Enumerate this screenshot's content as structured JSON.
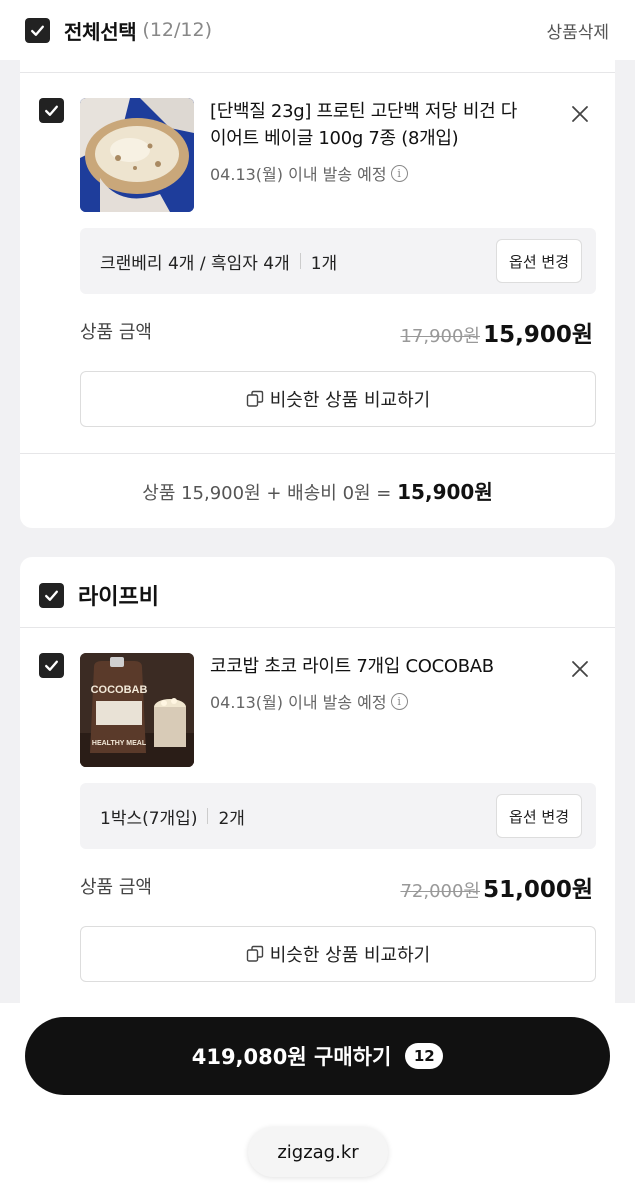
{
  "header": {
    "select_all_label": "전체선택",
    "count": "(12/12)",
    "delete_label": "상품삭제"
  },
  "items": [
    {
      "name_line1": "[단백질 23g] 프로틴 고단백 저당 비건 다",
      "name_line2": "이어트 베이글 100g 7종 (8개입)",
      "shipping": "04.13(월) 이내 발송 예정",
      "option": "크랜베리 4개 / 흑임자 4개",
      "quantity": "1개",
      "option_change_label": "옵션 변경",
      "price_label": "상품 금액",
      "original_price": "17,900원",
      "final_price": "15,900원",
      "compare_label": "비슷한 상품 비교하기",
      "summary_prefix": "상품 15,900원 + 배송비 0원 =",
      "summary_total": "15,900원"
    },
    {
      "store_name": "라이프비",
      "name_line1": "코코밥 초코 라이트 7개입 COCOBAB",
      "shipping": "04.13(월) 이내 발송 예정",
      "option": "1박스(7개입)",
      "quantity": "2개",
      "option_change_label": "옵션 변경",
      "price_label": "상품 금액",
      "original_price": "72,000원",
      "final_price": "51,000원",
      "compare_label": "비슷한 상품 비교하기",
      "thumb_text": "COCOBAB",
      "thumb_subtext": "HEALTHY MEAL"
    }
  ],
  "footer": {
    "buy_label": "419,080원 구매하기",
    "buy_count": "12",
    "domain": "zigzag.kr"
  },
  "colors": {
    "primary": "#111111",
    "background": "#f1f1f3",
    "muted_text": "#888888"
  }
}
